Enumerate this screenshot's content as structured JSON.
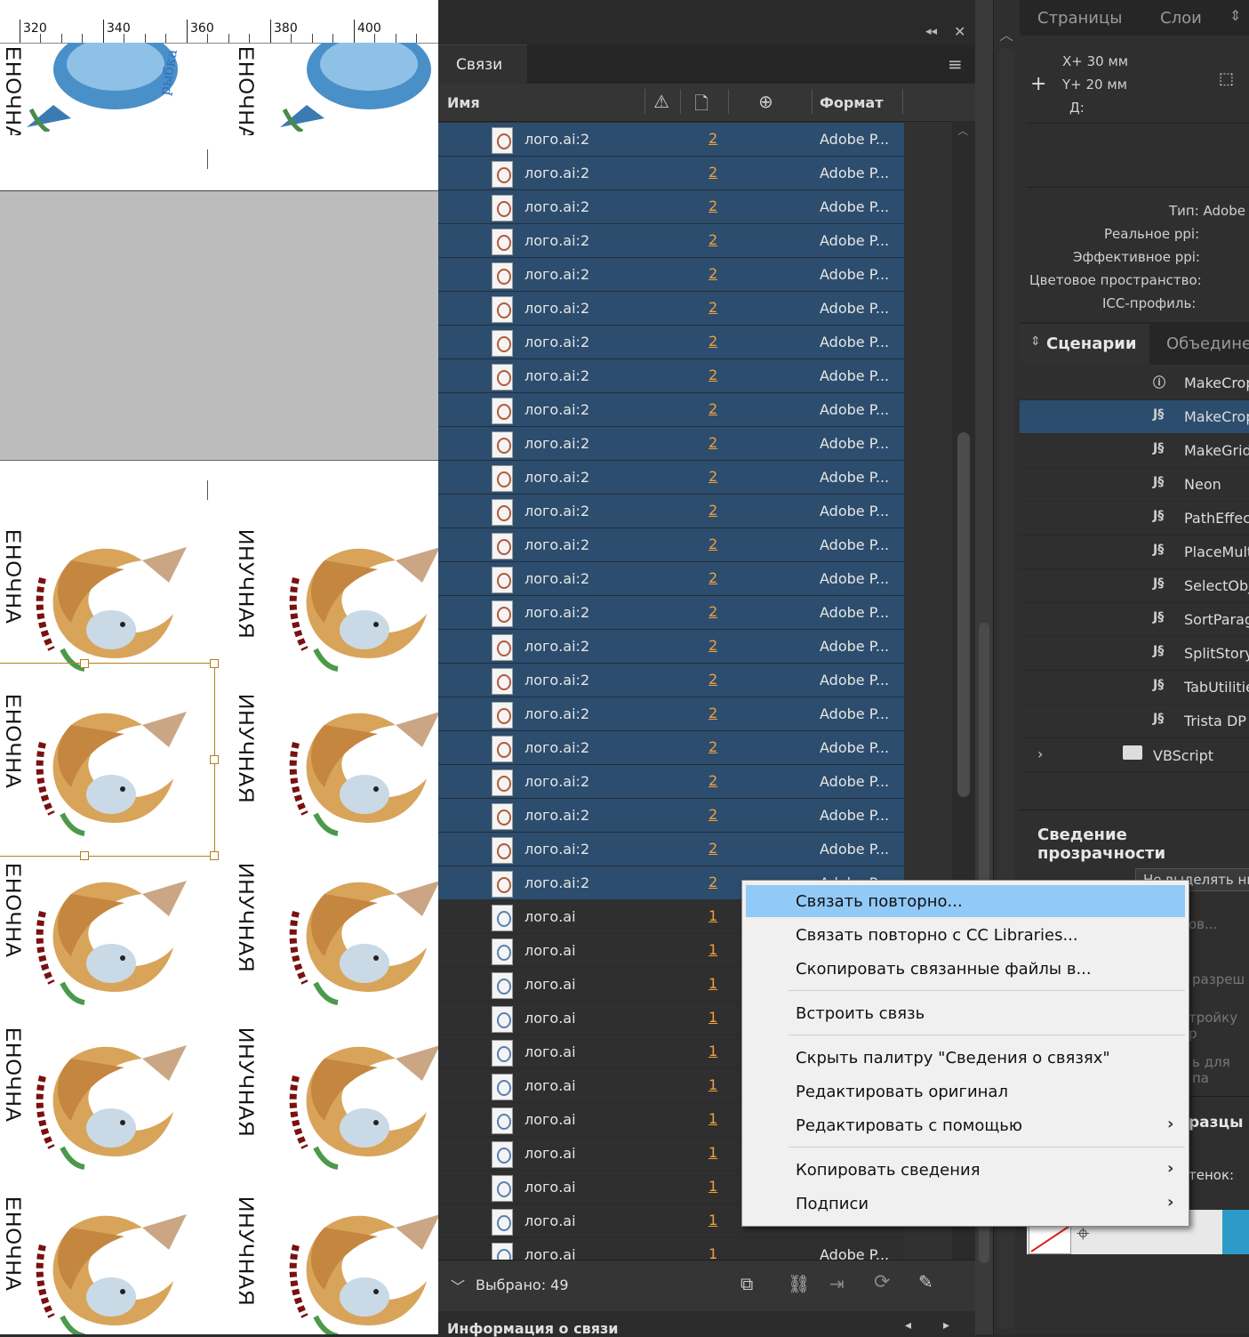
{
  "ruler": {
    "labels": [
      "320",
      "340",
      "360",
      "380",
      "400"
    ]
  },
  "canvas": {
    "vertical_text": [
      "ЕНОЧНА",
      "ИНУЧНАЯ"
    ]
  },
  "links_panel": {
    "tab_label": "Связи",
    "collapse_icon": "double-chevron-left-icon",
    "close_icon": "close-icon",
    "menu_icon": "hamburger-icon",
    "columns": {
      "name": "Имя",
      "format": "Формат"
    },
    "selected_rows": [
      {
        "name": "лого.ai:2",
        "page": "2",
        "format": "Adobe P..."
      },
      {
        "name": "лого.ai:2",
        "page": "2",
        "format": "Adobe P..."
      },
      {
        "name": "лого.ai:2",
        "page": "2",
        "format": "Adobe P..."
      },
      {
        "name": "лого.ai:2",
        "page": "2",
        "format": "Adobe P..."
      },
      {
        "name": "лого.ai:2",
        "page": "2",
        "format": "Adobe P..."
      },
      {
        "name": "лого.ai:2",
        "page": "2",
        "format": "Adobe P..."
      },
      {
        "name": "лого.ai:2",
        "page": "2",
        "format": "Adobe P..."
      },
      {
        "name": "лого.ai:2",
        "page": "2",
        "format": "Adobe P..."
      },
      {
        "name": "лого.ai:2",
        "page": "2",
        "format": "Adobe P..."
      },
      {
        "name": "лого.ai:2",
        "page": "2",
        "format": "Adobe P..."
      },
      {
        "name": "лого.ai:2",
        "page": "2",
        "format": "Adobe P..."
      },
      {
        "name": "лого.ai:2",
        "page": "2",
        "format": "Adobe P..."
      },
      {
        "name": "лого.ai:2",
        "page": "2",
        "format": "Adobe P..."
      },
      {
        "name": "лого.ai:2",
        "page": "2",
        "format": "Adobe P..."
      },
      {
        "name": "лого.ai:2",
        "page": "2",
        "format": "Adobe P..."
      },
      {
        "name": "лого.ai:2",
        "page": "2",
        "format": "Adobe P..."
      },
      {
        "name": "лого.ai:2",
        "page": "2",
        "format": "Adobe P..."
      },
      {
        "name": "лого.ai:2",
        "page": "2",
        "format": "Adobe P..."
      },
      {
        "name": "лого.ai:2",
        "page": "2",
        "format": "Adobe P..."
      },
      {
        "name": "лого.ai:2",
        "page": "2",
        "format": "Adobe P..."
      },
      {
        "name": "лого.ai:2",
        "page": "2",
        "format": "Adobe P..."
      },
      {
        "name": "лого.ai:2",
        "page": "2",
        "format": "Adobe P..."
      },
      {
        "name": "лого.ai:2",
        "page": "2",
        "format": "Adobe P..."
      }
    ],
    "normal_rows": [
      {
        "name": "лого.ai",
        "page": "1",
        "format": ""
      },
      {
        "name": "лого.ai",
        "page": "1",
        "format": ""
      },
      {
        "name": "лого.ai",
        "page": "1",
        "format": ""
      },
      {
        "name": "лого.ai",
        "page": "1",
        "format": ""
      },
      {
        "name": "лого.ai",
        "page": "1",
        "format": ""
      },
      {
        "name": "лого.ai",
        "page": "1",
        "format": ""
      },
      {
        "name": "лого.ai",
        "page": "1",
        "format": ""
      },
      {
        "name": "лого.ai",
        "page": "1",
        "format": ""
      },
      {
        "name": "лого.ai",
        "page": "1",
        "format": ""
      },
      {
        "name": "лого.ai",
        "page": "1",
        "format": ""
      },
      {
        "name": "лого.ai",
        "page": "1",
        "format": "Adobe P..."
      }
    ],
    "footer": {
      "selected_count": "Выбрано: 49"
    },
    "info_title": "Информация о связи"
  },
  "right_panel": {
    "tabs": [
      "Страницы",
      "Слои"
    ],
    "coords": {
      "x": "X+ 30 мм",
      "y": "Y+ 20 мм",
      "d": "Д:"
    },
    "info": {
      "type": "Тип: Adobe",
      "real_ppi": "Реальное ppi:",
      "eff_ppi": "Эффективное ppi:",
      "color_space": "Цветовое пространство:",
      "icc": "ICC-профиль:"
    },
    "scripts_tabs": [
      "Сценарии",
      "Объедине"
    ],
    "scripts": [
      "MakeCrop",
      "MakeCrop",
      "MakeGrid",
      "Neon",
      "PathEffec",
      "PlaceMult",
      "SelectObj",
      "SortParag",
      "SplitStory",
      "TabUtilitie",
      "Trista DP"
    ],
    "folder": "VBScript",
    "flatten_title": "Сведение прозрачности",
    "partial": [
      "Не выделять ни",
      "ов...",
      "разреш",
      "тройку р",
      "ь для па",
      "разцы",
      "тенок:"
    ]
  },
  "context_menu": {
    "items": [
      "Связать повторно...",
      "Связать повторно с CC Libraries...",
      "Скопировать связанные файлы в...",
      "Встроить связь",
      "Скрыть палитру \"Сведения о связях\"",
      "Редактировать оригинал",
      "Редактировать с помощью",
      "Копировать сведения",
      "Подписи"
    ]
  },
  "colors": {
    "selection": "#2c4d6e",
    "menu_highlight": "#91c9f7",
    "page_link": "#f0a040"
  }
}
